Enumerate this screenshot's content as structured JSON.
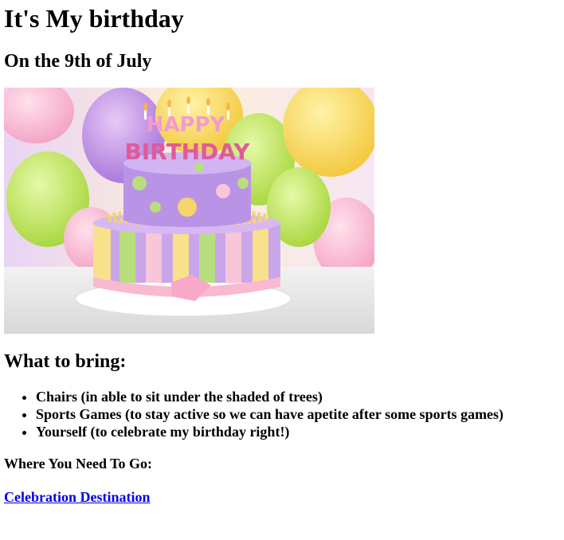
{
  "header": {
    "title": "It's My birthday",
    "date": "On the 9th of July"
  },
  "image": {
    "description_icon": "birthday-cake-image",
    "cake_lettering": [
      "HAPPY",
      "BIRTHDAY"
    ]
  },
  "bring": {
    "heading": "What to bring:",
    "items": [
      "Chairs (in able to sit under the shaded of trees)",
      "Sports Games (to stay active so we can have apetite after some sports games)",
      "Yourself (to celebrate my birthday right!)"
    ]
  },
  "location": {
    "heading": "Where You Need To Go:",
    "link_text": "Celebration Destination"
  },
  "colors": {
    "link": "#0000ee",
    "text": "#000000"
  }
}
